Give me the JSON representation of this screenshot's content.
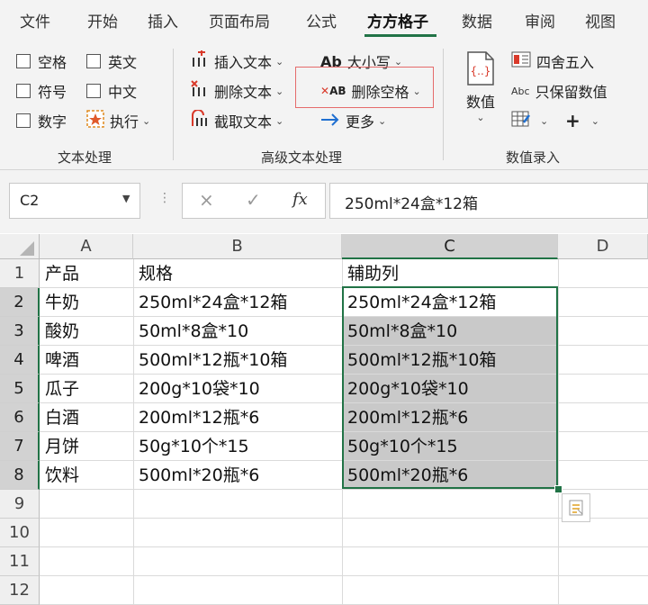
{
  "menu": {
    "tabs": [
      "文件",
      "开始",
      "插入",
      "页面布局",
      "公式",
      "方方格子",
      "数据",
      "审阅",
      "视图"
    ],
    "active_tab": "方方格子"
  },
  "ribbon": {
    "text_group": {
      "label": "文本处理",
      "checkboxes": [
        "空格",
        "英文",
        "符号",
        "中文",
        "数字"
      ],
      "execute_label": "执行"
    },
    "advanced_group": {
      "label": "高级文本处理",
      "insert_text": "插入文本",
      "delete_text": "删除文本",
      "extract_text": "截取文本",
      "case_label": "大小写",
      "delete_space": "删除空格",
      "more_label": "更多"
    },
    "numeric_group": {
      "label": "数值录入",
      "value_label": "数值",
      "round_label": "四舍五入",
      "keep_numeric": "只保留数值",
      "plus_label": "+"
    }
  },
  "formula_bar": {
    "name_box": "C2",
    "cancel_glyph": "×",
    "confirm_glyph": "✓",
    "fx_glyph": "fx",
    "formula": "250ml*24盒*12箱"
  },
  "grid": {
    "columns": [
      "A",
      "B",
      "C",
      "D"
    ],
    "rows": [
      "1",
      "2",
      "3",
      "4",
      "5",
      "6",
      "7",
      "8",
      "9",
      "10",
      "11",
      "12"
    ],
    "cells": [
      [
        "产品",
        "规格",
        "辅助列"
      ],
      [
        "牛奶",
        "250ml*24盒*12箱",
        "250ml*24盒*12箱"
      ],
      [
        "酸奶",
        "50ml*8盒*10",
        "50ml*8盒*10"
      ],
      [
        "啤酒",
        "500ml*12瓶*10箱",
        "500ml*12瓶*10箱"
      ],
      [
        "瓜子",
        "200g*10袋*10",
        "200g*10袋*10"
      ],
      [
        "白酒",
        "200ml*12瓶*6",
        "200ml*12瓶*6"
      ],
      [
        "月饼",
        "50g*10个*15",
        "50g*10个*15"
      ],
      [
        "饮料",
        "500ml*20瓶*6",
        "500ml*20瓶*6"
      ]
    ],
    "selected_range": "C2:C8",
    "active_cell": "C2"
  },
  "colors": {
    "accent": "#217346",
    "highlight_box": "#e56b6b",
    "selection_fill": "#c9c9c9"
  }
}
